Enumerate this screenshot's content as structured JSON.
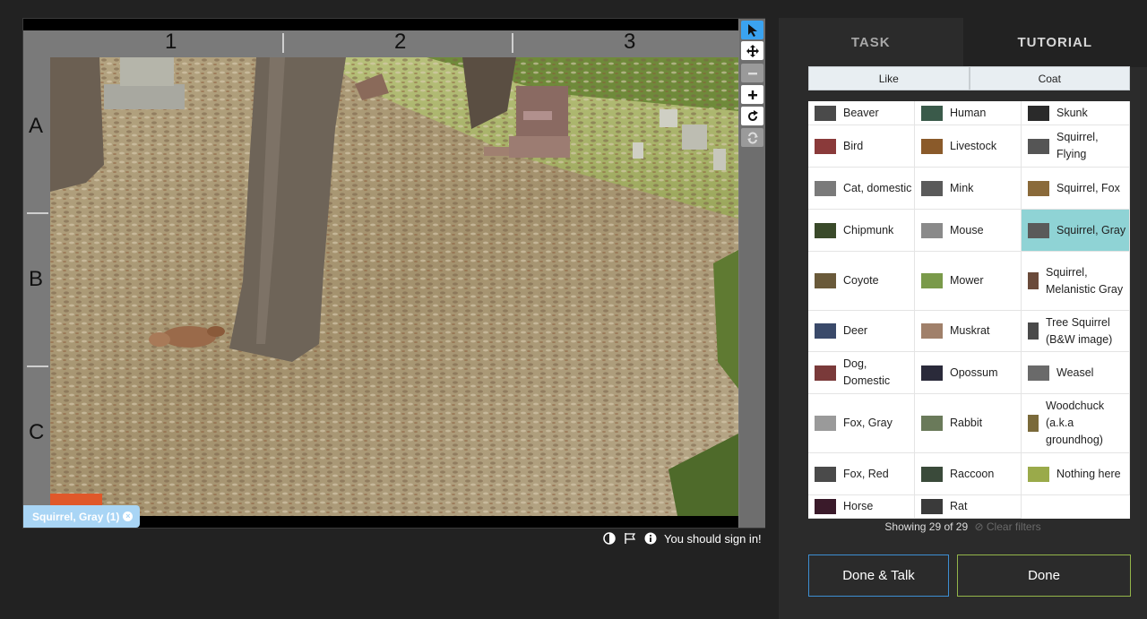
{
  "viewer": {
    "grid_columns": [
      "1",
      "2",
      "3"
    ],
    "grid_rows": [
      "A",
      "B",
      "C"
    ],
    "tag_chip": "Squirrel, Gray (1)",
    "tag_chip_close": "×"
  },
  "meta": {
    "sign_in_text": "You should sign in!"
  },
  "panel": {
    "tabs": [
      "TASK",
      "TUTORIAL"
    ],
    "filters": [
      "Like",
      "Coat"
    ],
    "choices": [
      {
        "label": "Beaver",
        "color": "#4a4a4a"
      },
      {
        "label": "Human",
        "color": "#3a5a4a"
      },
      {
        "label": "Skunk",
        "color": "#2a2a2a"
      },
      {
        "label": "Bird",
        "color": "#8a3a3a"
      },
      {
        "label": "Livestock",
        "color": "#8a5a2a"
      },
      {
        "label": "Squirrel, Flying",
        "color": "#555555"
      },
      {
        "label": "Cat, domestic",
        "color": "#7a7a7a"
      },
      {
        "label": "Mink",
        "color": "#5a5a5a"
      },
      {
        "label": "Squirrel, Fox",
        "color": "#8a6a3a"
      },
      {
        "label": "Chipmunk",
        "color": "#3a4a2a"
      },
      {
        "label": "Mouse",
        "color": "#8a8a8a"
      },
      {
        "label": "Squirrel, Gray",
        "color": "#5a5a5a"
      },
      {
        "label": "Coyote",
        "color": "#6a5a3a"
      },
      {
        "label": "Mower",
        "color": "#7a9a4a"
      },
      {
        "label": "Squirrel, Melanistic Gray",
        "color": "#6a4a3a"
      },
      {
        "label": "Deer",
        "color": "#3a4a6a"
      },
      {
        "label": "Muskrat",
        "color": "#a0806a"
      },
      {
        "label": "Tree Squirrel (B&W image)",
        "color": "#4a4a4a"
      },
      {
        "label": "Dog, Domestic",
        "color": "#7a3a3a"
      },
      {
        "label": "Opossum",
        "color": "#2a2a3a"
      },
      {
        "label": "Weasel",
        "color": "#6a6a6a"
      },
      {
        "label": "Fox, Gray",
        "color": "#9a9a9a"
      },
      {
        "label": "Rabbit",
        "color": "#6a7a5a"
      },
      {
        "label": "Woodchuck (a.k.a groundhog)",
        "color": "#7a6a3a"
      },
      {
        "label": "Fox, Red",
        "color": "#4a4a4a"
      },
      {
        "label": "Raccoon",
        "color": "#3a4a3a"
      },
      {
        "label": "Nothing here",
        "color": "#9aaa4a"
      },
      {
        "label": "Horse",
        "color": "#3a1a2a"
      },
      {
        "label": "Rat",
        "color": "#3a3a3a"
      }
    ],
    "status_text": "Showing 29 of 29",
    "clear_filters": "Clear filters",
    "done_talk_label": "Done & Talk",
    "done_label": "Done"
  },
  "colors": {
    "background": "#222222",
    "selected_choice": "#8fd3d5",
    "done_talk_border": "#3d8ed2",
    "done_border": "#94b54a",
    "active_tool": "#3aa3f0"
  }
}
